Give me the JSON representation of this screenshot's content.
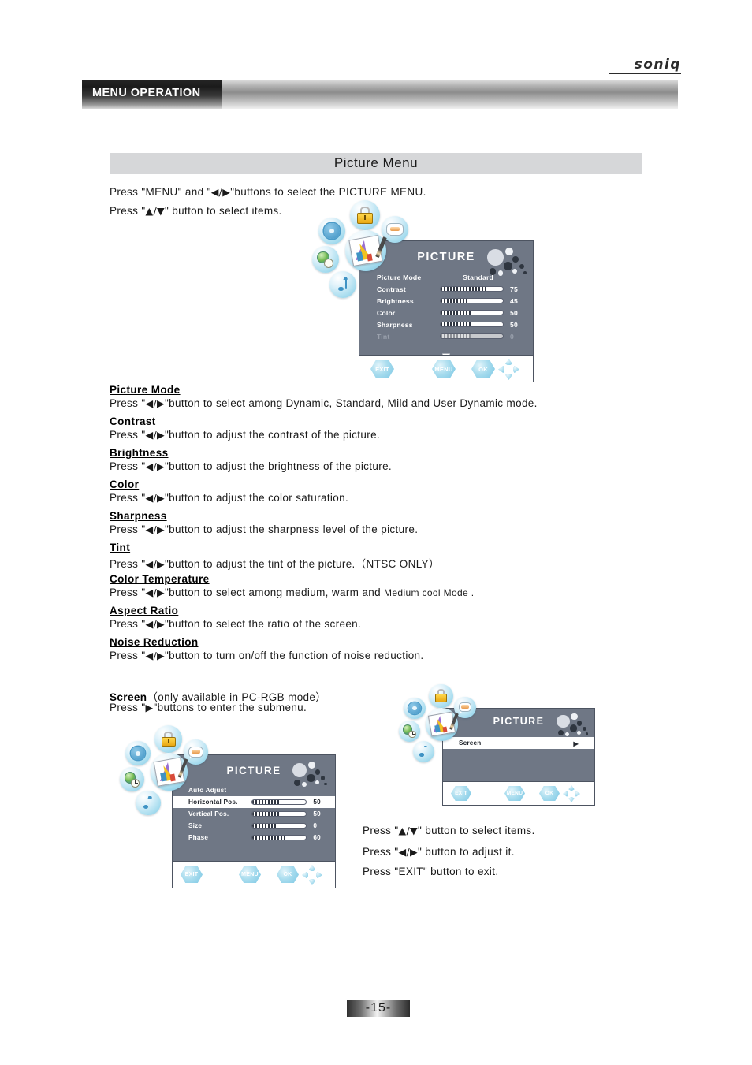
{
  "brand": {
    "logo_text": "soniq"
  },
  "header": {
    "tab_label": "MENU OPERATION"
  },
  "section": {
    "banner_title": "Picture Menu"
  },
  "intro": {
    "line1_a": "Press \"MENU\" and \"",
    "line1_arrows": "◀/▶",
    "line1_b": "\"buttons to select the PICTURE MENU.",
    "line2_a": "Press \"",
    "line2_arrows": "▲/▼",
    "line2_b": "\" button to select items."
  },
  "osd_main": {
    "title": "PICTURE",
    "scroll_down_glyph": "▼",
    "rows": [
      {
        "label": "Picture Mode",
        "value_text": "Standard",
        "type": "text"
      },
      {
        "label": "Contrast",
        "value_text": "75",
        "type": "bar",
        "percent": 75
      },
      {
        "label": "Brightness",
        "value_text": "45",
        "type": "bar",
        "percent": 45
      },
      {
        "label": "Color",
        "value_text": "50",
        "type": "bar",
        "percent": 50
      },
      {
        "label": "Sharpness",
        "value_text": "50",
        "type": "bar",
        "percent": 50
      },
      {
        "label": "Tint",
        "value_text": "0",
        "type": "bar",
        "percent": 48,
        "disabled": true
      }
    ],
    "nav": {
      "exit": "EXIT",
      "menu": "MENU",
      "ok": "OK"
    }
  },
  "osd_screen_entry": {
    "title": "PICTURE",
    "rows": [
      {
        "label": "Screen",
        "value_text": "▶",
        "type": "text",
        "selected": true
      }
    ],
    "nav": {
      "exit": "EXIT",
      "menu": "MENU",
      "ok": "OK"
    }
  },
  "osd_screen_sub": {
    "title": "PICTURE",
    "rows": [
      {
        "label": "Auto Adjust",
        "value_text": "",
        "type": "none"
      },
      {
        "label": "Horizontal Pos.",
        "value_text": "50",
        "type": "bar",
        "percent": 50,
        "selected": true
      },
      {
        "label": "Vertical Pos.",
        "value_text": "50",
        "type": "bar",
        "percent": 50
      },
      {
        "label": "Size",
        "value_text": "0",
        "type": "bar",
        "percent": 45
      },
      {
        "label": "Phase",
        "value_text": "60",
        "type": "bar",
        "percent": 60
      }
    ],
    "nav": {
      "exit": "EXIT",
      "menu": "MENU",
      "ok": "OK"
    }
  },
  "descriptions": [
    {
      "heading": "Picture Mode",
      "press": "Press \"",
      "arrows": "◀/▶",
      "body": "\"button to select among Dynamic, Standard, Mild and User  Dynamic  mode."
    },
    {
      "heading": "Contrast",
      "press": "Press \"",
      "arrows": "◀/▶",
      "body": "\"button to adjust the contrast of the picture."
    },
    {
      "heading": "Brightness",
      "press": "Press \"",
      "arrows": "◀/▶",
      "body": "\"button to adjust the brightness of the picture."
    },
    {
      "heading": "Color",
      "press": "Press \"",
      "arrows": "◀/▶",
      "body": "\"button to adjust the color saturation."
    },
    {
      "heading": "Sharpness",
      "press": "Press \"",
      "arrows": "◀/▶",
      "body": "\"button to adjust the sharpness level of the picture."
    },
    {
      "heading": "Tint",
      "press": "Press \"",
      "arrows": "◀/▶",
      "body": "\"button to adjust the tint of the picture.（NTSC ONLY）"
    },
    {
      "heading": "Color Temperature",
      "press": "Press \"",
      "arrows": "◀/▶",
      "body": "\"button to select among medium, warm and ",
      "body_small": "Medium  cool Mode  ."
    },
    {
      "heading": "Aspect Ratio",
      "press": "Press \"",
      "arrows": "◀/▶",
      "body": "\"button to select the ratio of the screen."
    },
    {
      "heading": "Noise Reduction",
      "press": "Press \"",
      "arrows": "◀/▶",
      "body": "\"button to turn on/off the function of noise reduction."
    }
  ],
  "screen_block": {
    "heading": "Screen",
    "heading_note": "（only available in PC-RGB mode）",
    "press_a": "Press \"",
    "arrow": "▶",
    "press_b": "\"buttons to enter the submenu."
  },
  "screen_help": {
    "line1_a": "Press \"",
    "line1_arrows": "▲/▼",
    "line1_b": "\" button to select items.",
    "line2_a": "Press \"",
    "line2_arrows": "◀/▶",
    "line2_b": "\" button to adjust it.",
    "line3": "Press \"EXIT\" button to exit."
  },
  "footer": {
    "page_number": "-15-"
  },
  "colors": {
    "osd_bg": "#6f7785",
    "osd_border": "#4d5461",
    "banner_bg": "#d6d7d9",
    "accent_bubble": "#a9ddef",
    "lock_yellow": "#e8a712"
  }
}
